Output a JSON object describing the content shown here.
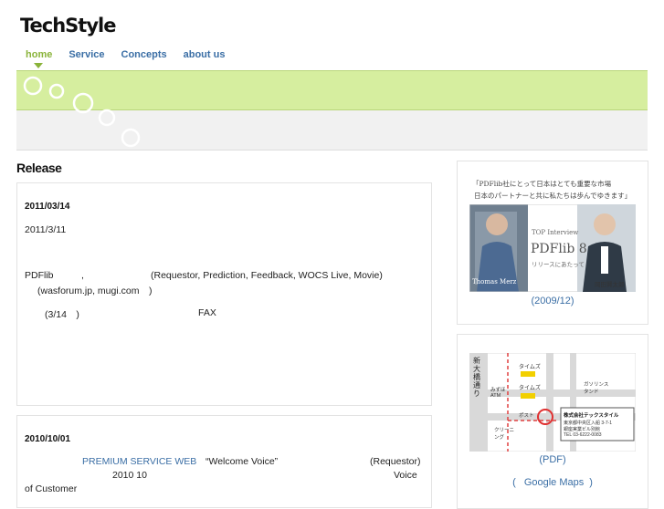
{
  "brand": {
    "logo": "TechStyle"
  },
  "nav": {
    "items": [
      {
        "label": "home",
        "active": true
      },
      {
        "label": "Service",
        "active": false
      },
      {
        "label": "Concepts",
        "active": false
      },
      {
        "label": "about us",
        "active": false
      }
    ]
  },
  "colors": {
    "accent": "#8ab33a",
    "link": "#3a6ea5",
    "band": "#d6ee9f"
  },
  "release": {
    "heading": "Release",
    "entries": [
      {
        "date": "2011/03/14",
        "line1": "2011/3/11",
        "line2a": "PDFlib",
        "line2b": ",",
        "line2c": "(Requestor, Prediction, Feedback, WOCS Live, Movie)",
        "line3": "(wasforum.jp, mugi.com　)",
        "line4a": "(3/14　)",
        "line4b": "FAX"
      },
      {
        "date": "2010/10/01",
        "link": "PREMIUM SERVICE WEB",
        "quote": "“Welcome Voice”",
        "req": "(Requestor)",
        "year": "2010 10",
        "voice": "Voice",
        "customer": "of Customer"
      }
    ]
  },
  "sidebar": {
    "interview": {
      "headline1": "「PDFlib社にとって日本はとても重要な市場",
      "headline2": "日本のパートナーと共に私たちは歩んでゆきます」",
      "left_name": "Thomas Merz",
      "tag": "TOP Interview",
      "product": "PDFlib 8",
      "sub": "リリースにあたって",
      "right_name": "岡田賢太郎",
      "caption": "(2009/12)"
    },
    "map": {
      "street": "新大橋通り",
      "timesA": "タイムズ",
      "timesB": "タイムズ",
      "bank": "みずほ ATM",
      "gas": "ガソリンスタンド",
      "post": "ポスト",
      "cleaning": "クリーニング",
      "company": "株式会社テックスタイル",
      "addr1": "東京都中央区入船 3-7-1",
      "addr2": "銀座実業ビル別館",
      "tel": "TEL 03-6222-0083",
      "caption_pdf": "(PDF)",
      "caption_open": "(",
      "caption_link": "Google Maps",
      "caption_close": ")"
    }
  }
}
